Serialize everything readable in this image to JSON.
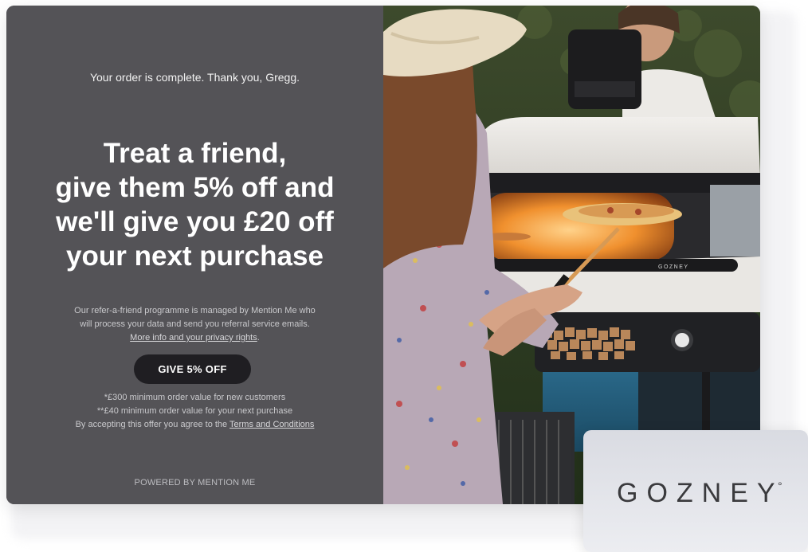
{
  "offer": {
    "confirmation": "Your order is complete. Thank you, Gregg.",
    "headline_lines": [
      "Treat a friend,",
      "give them 5% off and",
      "we'll give you £20 off",
      "your next purchase"
    ],
    "privacy_lines": [
      "Our refer-a-friend programme is managed by Mention Me who",
      "will process your data and send you referral service emails."
    ],
    "privacy_link": "More info and your privacy rights",
    "privacy_period": ".",
    "cta_label": "GIVE 5% OFF",
    "terms_lines": [
      "*£300 minimum order value for new customers",
      "**£40 minimum order value for your next purchase"
    ],
    "terms_prefix": "By accepting this offer you agree to the ",
    "terms_link": "Terms and Conditions",
    "powered_by": "POWERED BY MENTION ME"
  },
  "photo": {
    "oven_badge": "GOZNEY"
  },
  "brand": {
    "logo": "GOZNEY",
    "logo_mark": "°"
  },
  "colors": {
    "panel": "#545357",
    "cta": "#1f1e22",
    "logo_card": "#e6e7ec"
  }
}
